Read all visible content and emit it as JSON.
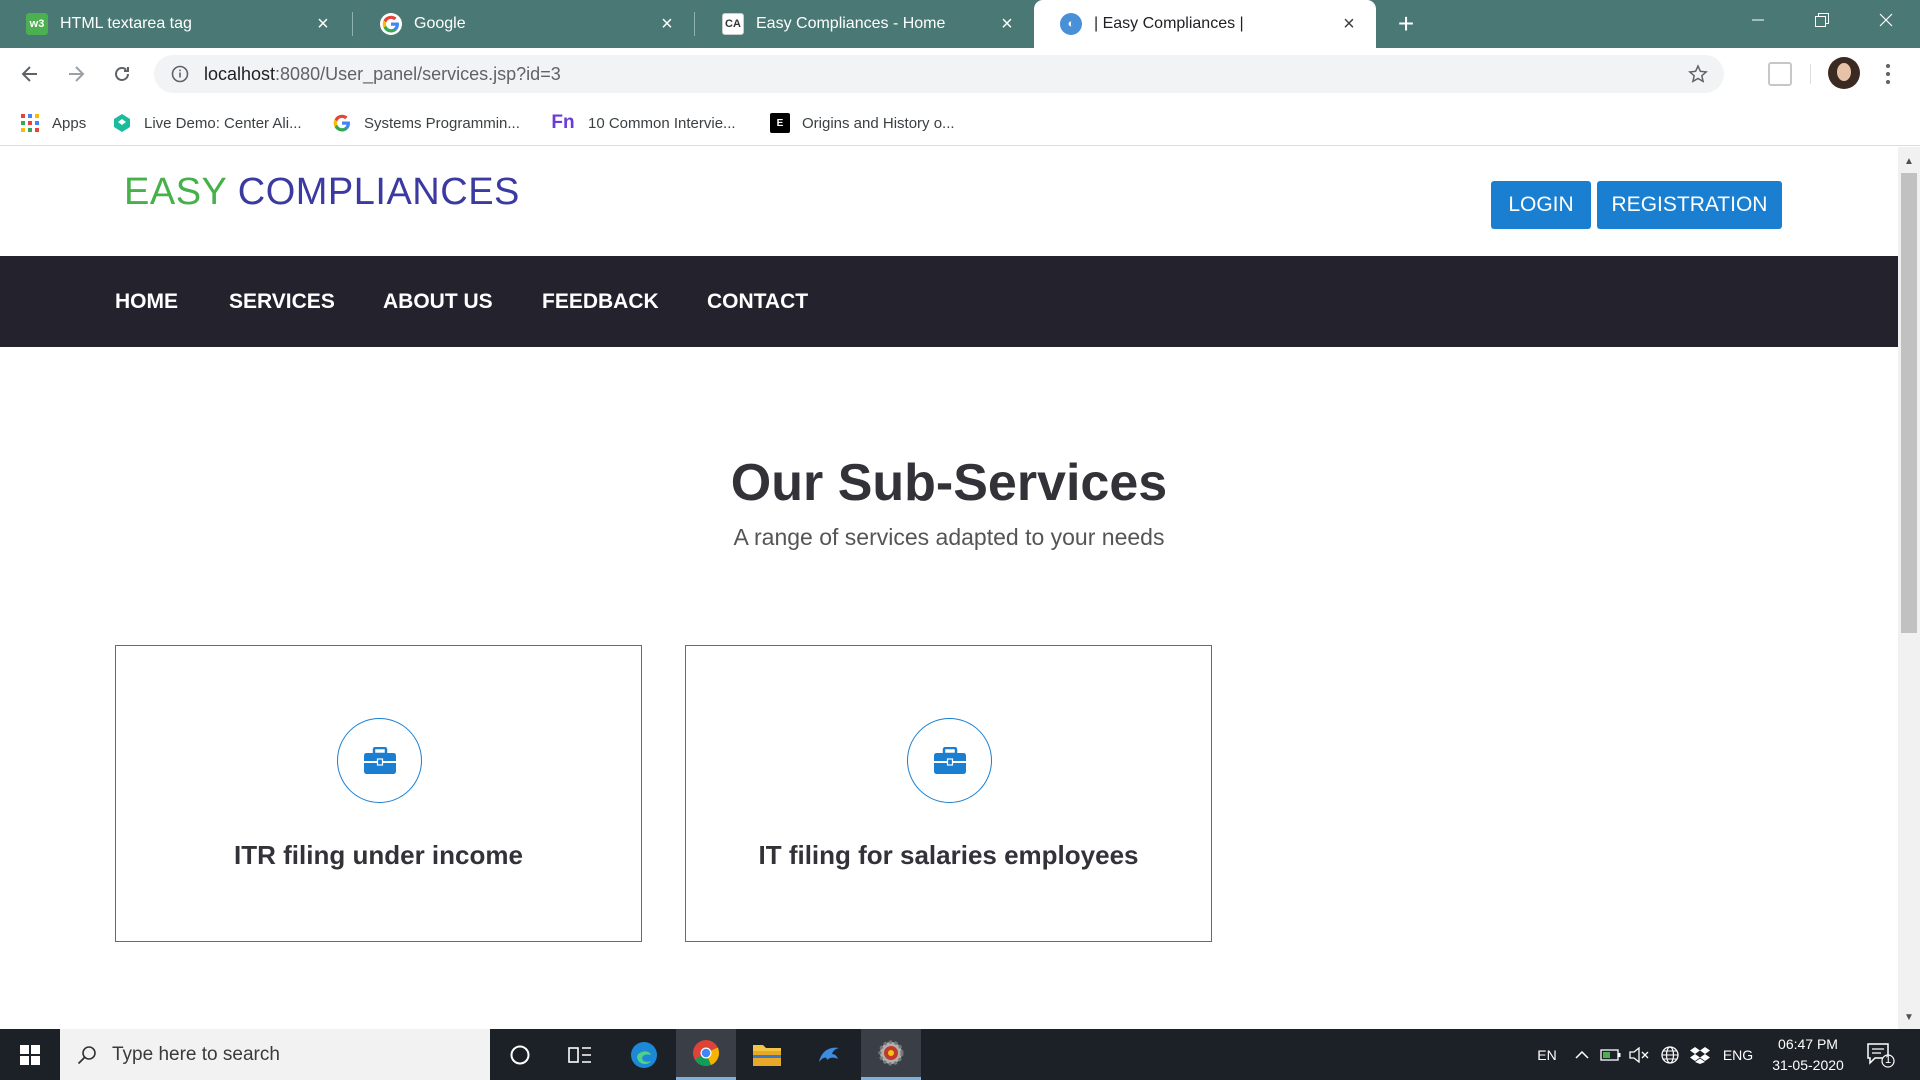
{
  "browser": {
    "tabs": [
      {
        "title": "HTML textarea tag",
        "favicon": "w3schools-icon",
        "active": false
      },
      {
        "title": "Google",
        "favicon": "google-icon",
        "active": false
      },
      {
        "title": "Easy Compliances - Home",
        "favicon": "site-logo-icon",
        "active": false
      },
      {
        "title": "| Easy Compliances |",
        "favicon": "globe-icon",
        "active": true
      }
    ],
    "url_host": "localhost",
    "url_path": ":8080/User_panel/services.jsp?id=3",
    "bookmarks": [
      {
        "label": "Apps",
        "icon": "apps-grid-icon"
      },
      {
        "label": "Live Demo: Center Ali...",
        "icon": "codepen-icon"
      },
      {
        "label": "Systems Programmin...",
        "icon": "google-icon"
      },
      {
        "label": "10 Common Intervie...",
        "icon": "fn-icon"
      },
      {
        "label": "Origins and History o...",
        "icon": "bookmark-page-icon"
      }
    ]
  },
  "site": {
    "logo_easy": "EASY",
    "logo_compliances": "COMPLIANCES",
    "login_label": "LOGIN",
    "registration_label": "REGISTRATION",
    "nav": [
      "HOME",
      "SERVICES",
      "ABOUT US",
      "FEEDBACK",
      "CONTACT"
    ],
    "section_title": "Our Sub-Services",
    "section_subtitle": "A range of services adapted to your needs",
    "cards": [
      {
        "title": "ITR filing under income",
        "icon": "briefcase-icon"
      },
      {
        "title": "IT filing for salaries employees",
        "icon": "briefcase-icon"
      }
    ],
    "colors": {
      "logo_green": "#46b04a",
      "logo_blue": "#3b3aa0",
      "accent_blue": "#1a7fd1",
      "nav_background": "#23222d",
      "tabstrip": "#4a7874"
    }
  },
  "taskbar": {
    "search_placeholder": "Type here to search",
    "lang": "EN",
    "ime": "ENG",
    "time": "06:47 PM",
    "date": "31-05-2020",
    "notification_count": "1"
  }
}
